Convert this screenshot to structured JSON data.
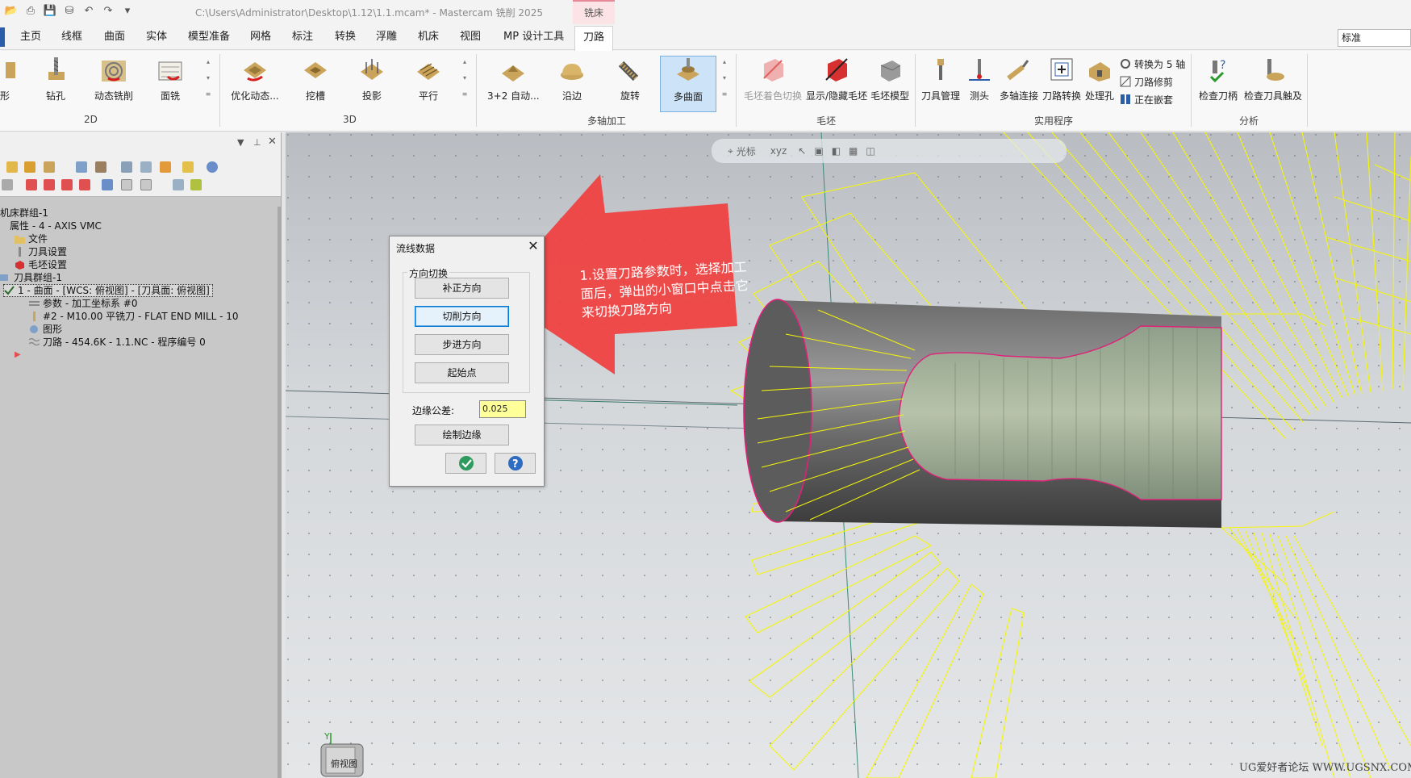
{
  "window": {
    "title": "C:\\Users\\Administrator\\Desktop\\1.12\\1.1.mcam* - Mastercam 铣削 2025",
    "context_tab": "铣床"
  },
  "menu": {
    "tabs": [
      "主页",
      "线框",
      "曲面",
      "实体",
      "模型准备",
      "网格",
      "标注",
      "转换",
      "浮雕",
      "机床",
      "视图",
      "MP 设计工具",
      "刀路"
    ],
    "active": "刀路",
    "view_field": "标准"
  },
  "ribbon": {
    "group_2d": {
      "label": "2D",
      "buttons": [
        "形",
        "钻孔",
        "动态铣削",
        "面铣"
      ]
    },
    "group_3d": {
      "label": "3D",
      "buttons": [
        "优化动态...",
        "挖槽",
        "投影",
        "平行"
      ]
    },
    "group_multiaxis": {
      "label": "多轴加工",
      "buttons": [
        "3+2 自动...",
        "沿边",
        "旋转",
        "多曲面"
      ],
      "selected": "多曲面"
    },
    "group_stock": {
      "label": "毛坯",
      "buttons": [
        "毛坯着色切换",
        "显示/隐藏毛坯",
        "毛坯模型"
      ]
    },
    "group_utility": {
      "label": "实用程序",
      "buttons": [
        "刀具管理",
        "测头",
        "多轴连接",
        "刀路转换",
        "处理孔"
      ],
      "small": [
        "转换为 5 轴",
        "刀路修剪",
        "正在嵌套"
      ]
    },
    "group_analysis": {
      "label": "分析",
      "buttons": [
        "检查刀柄",
        "检查刀具触及"
      ]
    }
  },
  "tree": {
    "items": [
      "机床群组-1",
      "属性 - 4 - AXIS VMC",
      "文件",
      "刀具设置",
      "毛坯设置",
      "刀具群组-1",
      "1 - 曲面 - [WCS: 俯视图] - [刀具面: 俯视图]",
      "参数 - 加工坐标系 #0",
      "#2 - M10.00 平铣刀 - FLAT END MILL - 10",
      "图形",
      "刀路 - 454.6K - 1.1.NC - 程序编号 0"
    ]
  },
  "viewport": {
    "toolbar_label": "光标",
    "toolbar_xyz": "xyz",
    "watermark": "UG爱好者论坛 WWW.UGSNX.COM",
    "viewcube_label": "俯视图",
    "axis_y": "Y",
    "annotation": "1.设置刀路参数时，选择加工面后，弹出的小窗口中点击它来切换刀路方向"
  },
  "dialog": {
    "title": "流线数据",
    "group_label": "方向切换",
    "buttons": [
      "补正方向",
      "切削方向",
      "步进方向",
      "起始点"
    ],
    "focused": "切削方向",
    "tolerance_label": "边缘公差:",
    "tolerance_value": "0.025",
    "draw_edge": "绘制边缘"
  },
  "colors": {
    "accent": "#2a5ea8",
    "arrow": "#f0403f",
    "toolpath": "#f5f50a",
    "edge": "#e0207a",
    "tolerance_bg": "#ffff99"
  }
}
